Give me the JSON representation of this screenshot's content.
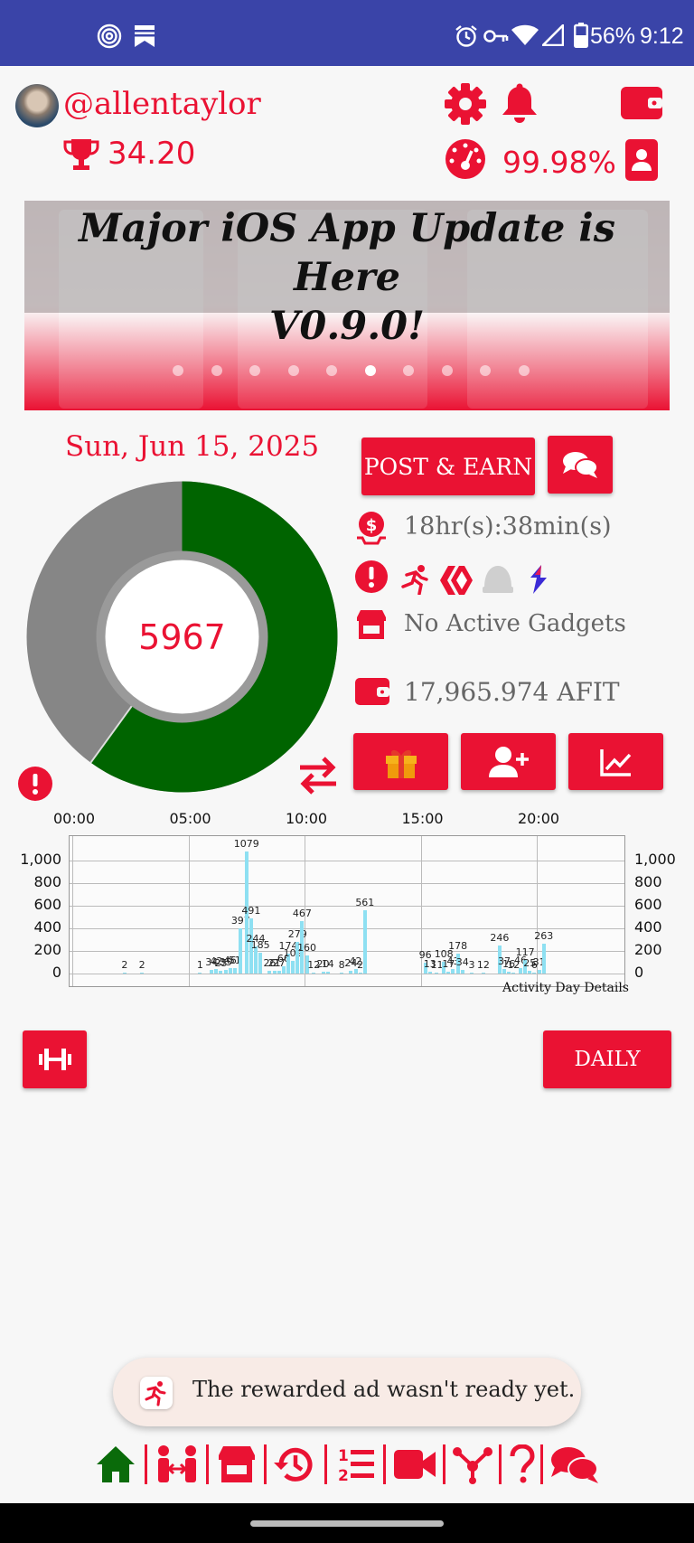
{
  "status": {
    "battery": "56%",
    "time": "9:12"
  },
  "user": {
    "username": "@allentaylor",
    "trophy_score": "34.20",
    "percent": "99.98%"
  },
  "banner": {
    "title_line1": "Major iOS App Update is Here",
    "title_line2": "V0.9.0!",
    "slide_count": 10,
    "active_slide": 5
  },
  "date": "Sun, Jun 15, 2025",
  "actions": {
    "post_earn": "POST & EARN"
  },
  "donut": {
    "center": "5967",
    "green_fraction": 0.6
  },
  "info": {
    "timer": "18hr(s):38min(s)",
    "gadgets": "No Active Gadgets",
    "balance": "17,965.974 AFIT"
  },
  "chart_data": {
    "type": "bar",
    "x_ticks": [
      "00:00",
      "05:00",
      "10:00",
      "15:00",
      "20:00"
    ],
    "y_ticks": [
      "1,000",
      "800",
      "600",
      "400",
      "200",
      "0"
    ],
    "ylim": [
      0,
      1200
    ],
    "caption": "Activity Day Details",
    "bars": [
      {
        "hour": 2.25,
        "value": 2
      },
      {
        "hour": 3.0,
        "value": 2
      },
      {
        "hour": 5.5,
        "value": 1
      },
      {
        "hour": 6.0,
        "value": 34
      },
      {
        "hour": 6.2,
        "value": 42
      },
      {
        "hour": 6.4,
        "value": 25
      },
      {
        "hour": 6.6,
        "value": 35
      },
      {
        "hour": 6.8,
        "value": 46
      },
      {
        "hour": 7.0,
        "value": 51
      },
      {
        "hour": 7.25,
        "value": 397
      },
      {
        "hour": 7.5,
        "value": 1079
      },
      {
        "hour": 7.7,
        "value": 491
      },
      {
        "hour": 7.9,
        "value": 244
      },
      {
        "hour": 8.1,
        "value": 185
      },
      {
        "hour": 8.5,
        "value": 26
      },
      {
        "hour": 8.7,
        "value": 21
      },
      {
        "hour": 8.9,
        "value": 27
      },
      {
        "hour": 9.1,
        "value": 66
      },
      {
        "hour": 9.3,
        "value": 174
      },
      {
        "hour": 9.5,
        "value": 109
      },
      {
        "hour": 9.7,
        "value": 279
      },
      {
        "hour": 9.9,
        "value": 467
      },
      {
        "hour": 10.1,
        "value": 160
      },
      {
        "hour": 10.4,
        "value": 12
      },
      {
        "hour": 10.8,
        "value": 20
      },
      {
        "hour": 11.0,
        "value": 14
      },
      {
        "hour": 11.6,
        "value": 8
      },
      {
        "hour": 12.0,
        "value": 24
      },
      {
        "hour": 12.2,
        "value": 42
      },
      {
        "hour": 12.4,
        "value": 2
      },
      {
        "hour": 12.6,
        "value": 561
      },
      {
        "hour": 15.2,
        "value": 96
      },
      {
        "hour": 15.4,
        "value": 13
      },
      {
        "hour": 15.7,
        "value": 11
      },
      {
        "hour": 16.0,
        "value": 108
      },
      {
        "hour": 16.2,
        "value": 17
      },
      {
        "hour": 16.4,
        "value": 43
      },
      {
        "hour": 16.6,
        "value": 178
      },
      {
        "hour": 16.8,
        "value": 34
      },
      {
        "hour": 17.2,
        "value": 3
      },
      {
        "hour": 17.7,
        "value": 12
      },
      {
        "hour": 18.4,
        "value": 246
      },
      {
        "hour": 18.6,
        "value": 37
      },
      {
        "hour": 18.8,
        "value": 16
      },
      {
        "hour": 19.0,
        "value": 12
      },
      {
        "hour": 19.3,
        "value": 46
      },
      {
        "hour": 19.5,
        "value": 117
      },
      {
        "hour": 19.7,
        "value": 25
      },
      {
        "hour": 19.9,
        "value": 6
      },
      {
        "hour": 20.1,
        "value": 31
      },
      {
        "hour": 20.3,
        "value": 263
      }
    ]
  },
  "bottom": {
    "daily": "DAILY"
  },
  "toast": "The rewarded ad wasn't ready yet."
}
